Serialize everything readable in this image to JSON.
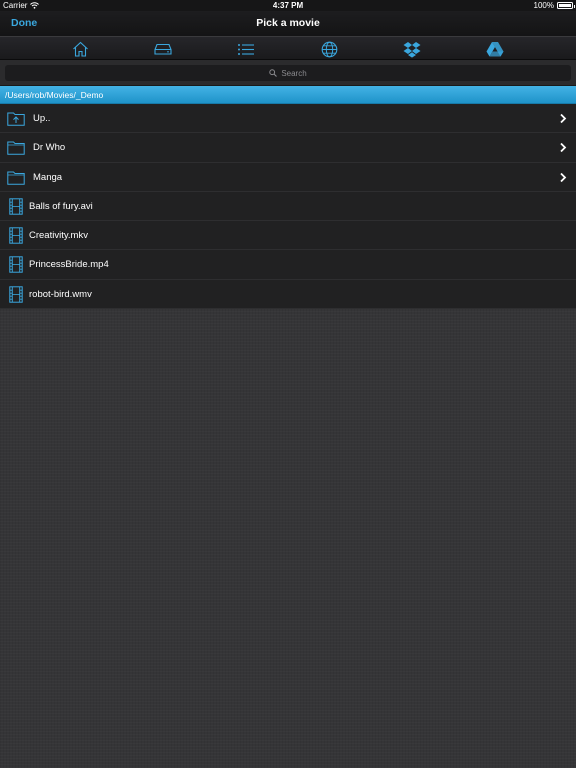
{
  "status_bar": {
    "carrier": "Carrier",
    "time": "4:37 PM",
    "battery_text": "100%",
    "battery_level": 1.0
  },
  "nav": {
    "done_label": "Done",
    "title": "Pick a movie"
  },
  "toolbar": {
    "icons": [
      "home-icon",
      "drive-icon",
      "list-icon",
      "globe-icon",
      "dropbox-icon",
      "google-drive-icon"
    ],
    "accent_color": "#3aa7de"
  },
  "search": {
    "placeholder": "Search"
  },
  "path": "/Users/rob/Movies/_Demo",
  "colors": {
    "path_bar": "#2aa0d8",
    "row_background": "#212122",
    "page_background": "#353537"
  },
  "items": [
    {
      "label": "Up..",
      "type": "up",
      "icon": "folder-up-icon"
    },
    {
      "label": "Dr Who",
      "type": "folder",
      "icon": "folder-icon"
    },
    {
      "label": "Manga",
      "type": "folder",
      "icon": "folder-icon"
    },
    {
      "label": "Balls of fury.avi",
      "type": "file",
      "icon": "film-icon"
    },
    {
      "label": "Creativity.mkv",
      "type": "file",
      "icon": "film-icon"
    },
    {
      "label": "PrincessBride.mp4",
      "type": "file",
      "icon": "film-icon"
    },
    {
      "label": "robot-bird.wmv",
      "type": "file",
      "icon": "film-icon"
    }
  ]
}
